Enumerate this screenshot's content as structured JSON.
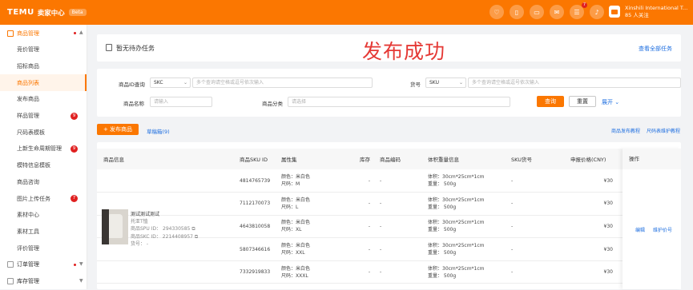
{
  "topbar": {
    "logo": "TEMU",
    "subtitle": "卖家中心",
    "beta": "Beta",
    "icons": [
      "heart-icon",
      "phone-icon",
      "tablet-icon",
      "chat-icon",
      "task-icon",
      "bell-icon"
    ],
    "task_badge": "7",
    "shop_name": "Xinshili International T...",
    "shop_sub": "85 人关注",
    "accent": "#fb7701"
  },
  "sidebar": {
    "group1": "商品管理",
    "items": [
      {
        "label": "竞价管理"
      },
      {
        "label": "招标商品"
      },
      {
        "label": "商品列表"
      },
      {
        "label": "发布商品"
      },
      {
        "label": "样品管理",
        "badge": "9"
      },
      {
        "label": "尺码表模板"
      },
      {
        "label": "上新生命周期管理",
        "badge": "9"
      },
      {
        "label": "模特信息模板"
      },
      {
        "label": "商品咨询"
      },
      {
        "label": "图片上传任务",
        "badge": "7"
      },
      {
        "label": "素材中心"
      },
      {
        "label": "素材工具"
      },
      {
        "label": "评价管理"
      }
    ],
    "group2": "订单管理",
    "group3": "库存管理"
  },
  "todo": {
    "title": "暂无待办任务",
    "overlay": "发布成功",
    "view_all": "查看全部任务"
  },
  "filters": {
    "id_label": "商品ID查询",
    "id_type": "SKC",
    "id_placeholder": "多个查询请空格或逗号依次输入",
    "sku_label": "货号",
    "sku_type": "SKU",
    "sku_placeholder": "多个查询请空格或逗号依次输入",
    "name_label": "商品名称",
    "name_placeholder": "请输入",
    "cat_label": "商品分类",
    "cat_placeholder": "请选择",
    "search": "查询",
    "reset": "重置",
    "expand": "展开"
  },
  "actions": {
    "publish": "+ 发布商品",
    "drafts": "草稿箱(9)",
    "tutorial": "商品发布教程",
    "size_tutorial": "尺码表维护教程"
  },
  "table": {
    "headers": [
      "商品信息",
      "商品SKU ID",
      "属性集",
      "库存",
      "商品编码",
      "体积重量信息",
      "SKU货号",
      "申报价格(CNY)",
      "操作"
    ],
    "product": {
      "name": "测试测试测试",
      "brand": "托亚T恤",
      "spu": "商品SPU ID： 294330585",
      "skc": "商品SKC ID： 2214408957",
      "code": "货号： -"
    },
    "rows": [
      {
        "id": "4814765739",
        "color": "颜色：米白色",
        "size": "尺码：M",
        "stock": "-",
        "code": "-",
        "vol": "体积：30cm*25cm*1cm",
        "weight": "重量： 500g",
        "sku": "-",
        "price": "¥30"
      },
      {
        "id": "7112170073",
        "color": "颜色：米白色",
        "size": "尺码：L",
        "stock": "-",
        "code": "-",
        "vol": "体积：30cm*25cm*1cm",
        "weight": "重量： 500g",
        "sku": "-",
        "price": "¥30"
      },
      {
        "id": "4643810058",
        "color": "颜色：米白色",
        "size": "尺码：XL",
        "stock": "-",
        "code": "-",
        "vol": "体积：30cm*25cm*1cm",
        "weight": "重量： 500g",
        "sku": "-",
        "price": "¥30"
      },
      {
        "id": "5807346616",
        "color": "颜色：米白色",
        "size": "尺码：XXL",
        "stock": "-",
        "code": "-",
        "vol": "体积：30cm*25cm*1cm",
        "weight": "重量： 500g",
        "sku": "-",
        "price": "¥30"
      },
      {
        "id": "7332919833",
        "color": "颜色：米白色",
        "size": "尺码：XXXL",
        "stock": "-",
        "code": "-",
        "vol": "体积：30cm*25cm*1cm",
        "weight": "重量： 500g",
        "sku": "-",
        "price": "¥30"
      }
    ],
    "op_edit": "编辑",
    "op_maintain": "维护价号"
  }
}
